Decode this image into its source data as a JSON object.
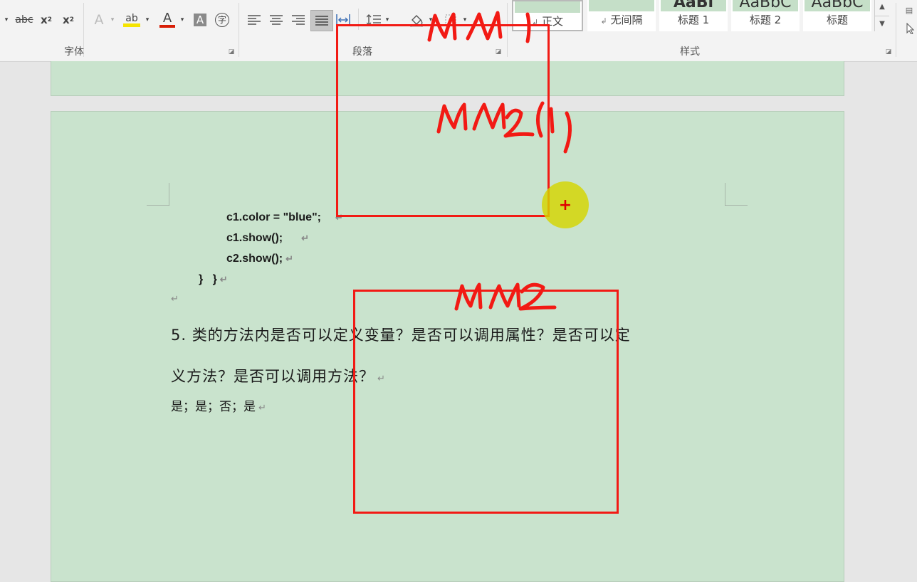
{
  "ribbon": {
    "groups": {
      "font": "字体",
      "paragraph": "段落",
      "styles": "样式"
    },
    "font_tools": {
      "strikethrough": "abc",
      "subscript": "x",
      "superscript": "x",
      "text_effect": "A",
      "highlight": "ab",
      "font_color": "A",
      "char_shading": "A",
      "enclose": "字"
    },
    "styles": [
      {
        "name": "正文",
        "mark": "↲"
      },
      {
        "name": "无间隔",
        "mark": "↲"
      },
      {
        "name": "标题 1",
        "preview": "AaBl"
      },
      {
        "name": "标题 2",
        "preview": "AaBbC"
      },
      {
        "name": "标题",
        "preview": "AaBbC"
      }
    ],
    "colors": {
      "highlight": "#f5e400",
      "font_color": "#d81e06"
    }
  },
  "document": {
    "code_lines": [
      "c1.color = \"blue\";",
      "c1.show();",
      "c2.show();",
      "}   }"
    ],
    "question": {
      "line1": "5. 类的方法内是否可以定义变量？是否可以调用属性？是否可以定",
      "line2": "义方法？是否可以调用方法？"
    },
    "answer": "是；是；否；是",
    "paragraph_mark": "↵"
  },
  "annotations": {
    "box1_label": "M1",
    "box1_sub": "M2(1)",
    "box2_label": "M2",
    "color": "#f21a14"
  },
  "cursor": {
    "symbol": "+",
    "ring_color": "#d6d600"
  }
}
